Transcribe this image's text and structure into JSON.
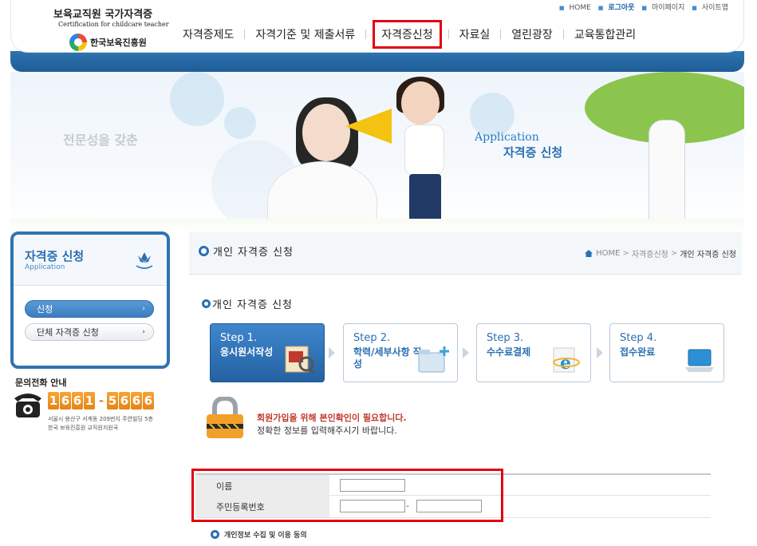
{
  "util_links": [
    "HOME",
    "로그아웃",
    "마이페이지",
    "사이트맵"
  ],
  "logo": {
    "title": "보육교직원 국가자격증",
    "subtitle": "Certification for childcare teacher",
    "org": "한국보육진흥원"
  },
  "gnb": {
    "items": [
      "자격증제도",
      "자격기준 및 제출서류",
      "자격증신청",
      "자료실",
      "열린광장",
      "교육통합관리"
    ],
    "active_index": 2
  },
  "banner": {
    "slogan": "전문성을 갖춘",
    "title_en": "Application",
    "title_ko": "자격증 신청"
  },
  "sidebar": {
    "title": "자격증 신청",
    "title_en": "Application",
    "items": [
      {
        "label": "신청",
        "active": true
      },
      {
        "label": "단체 자격증 신청",
        "active": false
      }
    ]
  },
  "phone": {
    "label": "문의전화 안내",
    "number_part1": "1661",
    "number_part2": "5666",
    "address": "서울시 용산구 서계동 209번지 주연빌딩 5층",
    "org_line": "한국 보육진흥원 교직원지원국"
  },
  "content": {
    "page_title": "개인 자격증 신청",
    "breadcrumb": [
      "HOME",
      "자격증신청",
      "개인 자격증 신청"
    ],
    "section_title": "개인 자격증 신청"
  },
  "steps": [
    {
      "num": "Step 1.",
      "name": "응시원서작성",
      "active": true,
      "icon": "application-form-icon"
    },
    {
      "num": "Step 2.",
      "name": "학력/세부사항 작성",
      "active": false,
      "icon": "folder-add-icon"
    },
    {
      "num": "Step 3.",
      "name": "수수료결제",
      "active": false,
      "icon": "internet-explorer-icon"
    },
    {
      "num": "Step 4.",
      "name": "접수완료",
      "active": false,
      "icon": "laptop-icon"
    }
  ],
  "notice": {
    "line1": "회원가입을 위해 본인확인이 필요합니다.",
    "line2": "정확한 정보를 입력해주시기 바랍니다."
  },
  "form": {
    "name_label": "이름",
    "name_value": "",
    "rrn_label": "주민등록번호",
    "rrn_front_value": "",
    "rrn_back_value": "",
    "rrn_separator": "-"
  },
  "privacy": {
    "label": "개인정보 수집 및 이용 동의"
  },
  "colors": {
    "primary": "#2a6fb2",
    "highlight": "#e3000f",
    "phone_orange": "#e5851a",
    "warning": "#c0392b"
  }
}
